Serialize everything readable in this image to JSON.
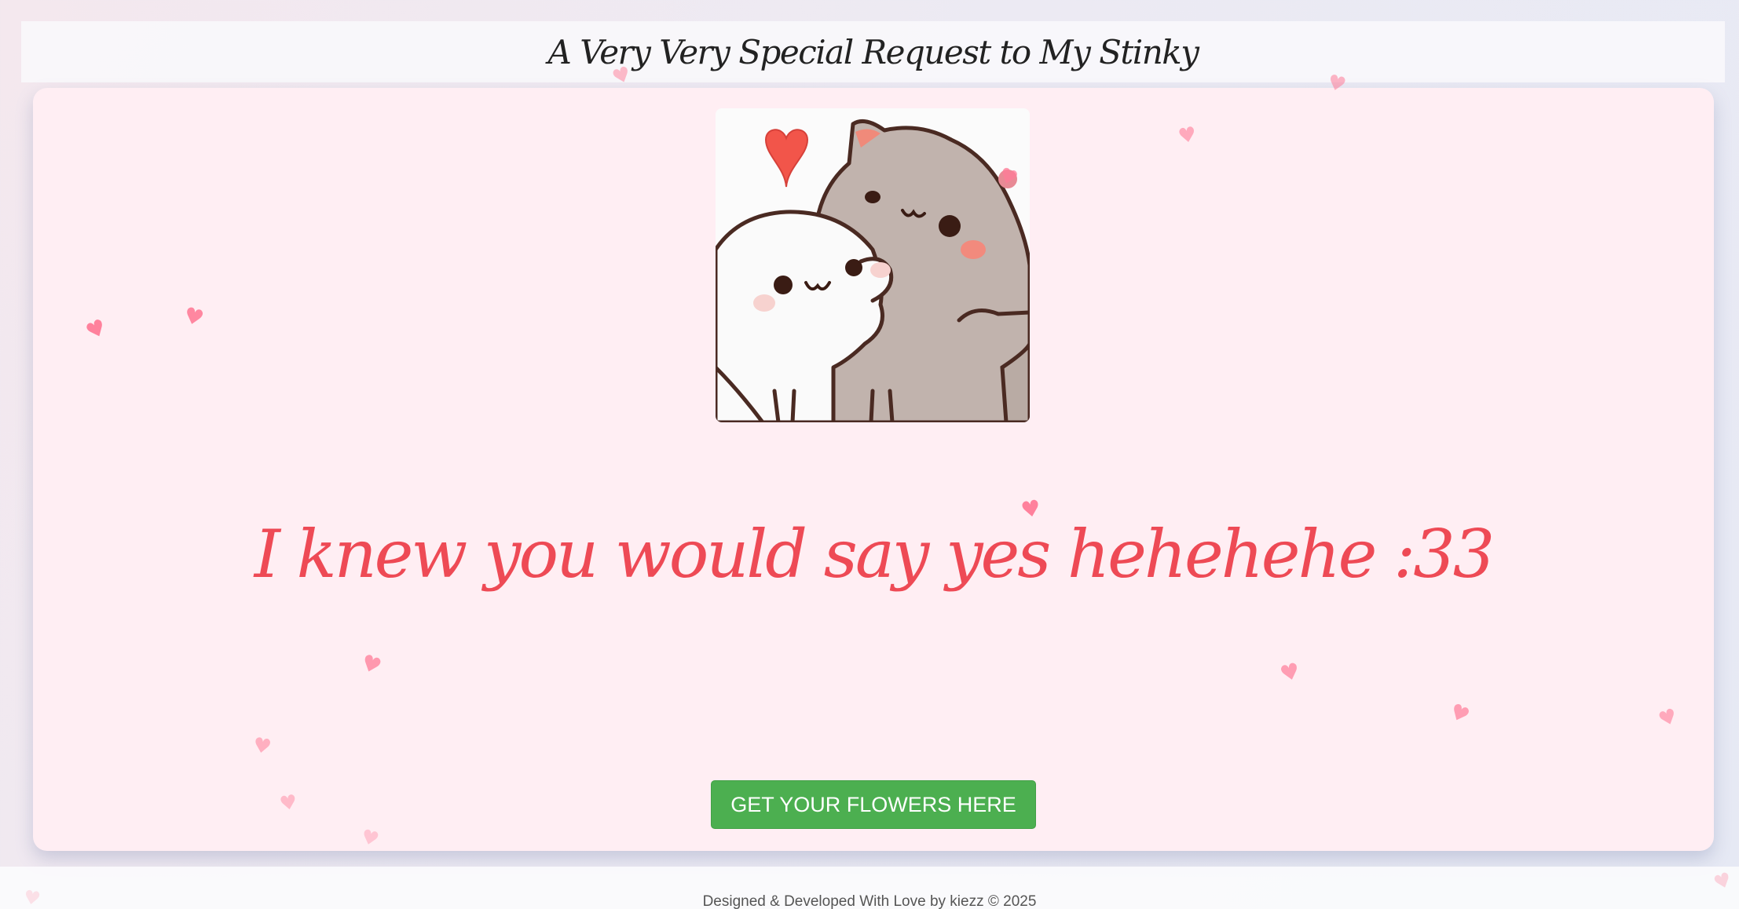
{
  "header": {
    "title": "A Very Very Special Request to My Stinky"
  },
  "main": {
    "image_alt": "two hugging cartoon cats with a heart",
    "message": "I knew you would say yes hehehehe :33",
    "button_label": "GET YOUR FLOWERS HERE"
  },
  "footer": {
    "credit": "Designed & Developed With Love by kiezz © 2025"
  },
  "decor": {
    "heart_icon": "heart-icon",
    "heart_glyph": "♥",
    "colors": {
      "heart": "#ff7c98",
      "message": "#ee4a55",
      "button": "#4caf50",
      "card": "#ffeef3"
    }
  }
}
